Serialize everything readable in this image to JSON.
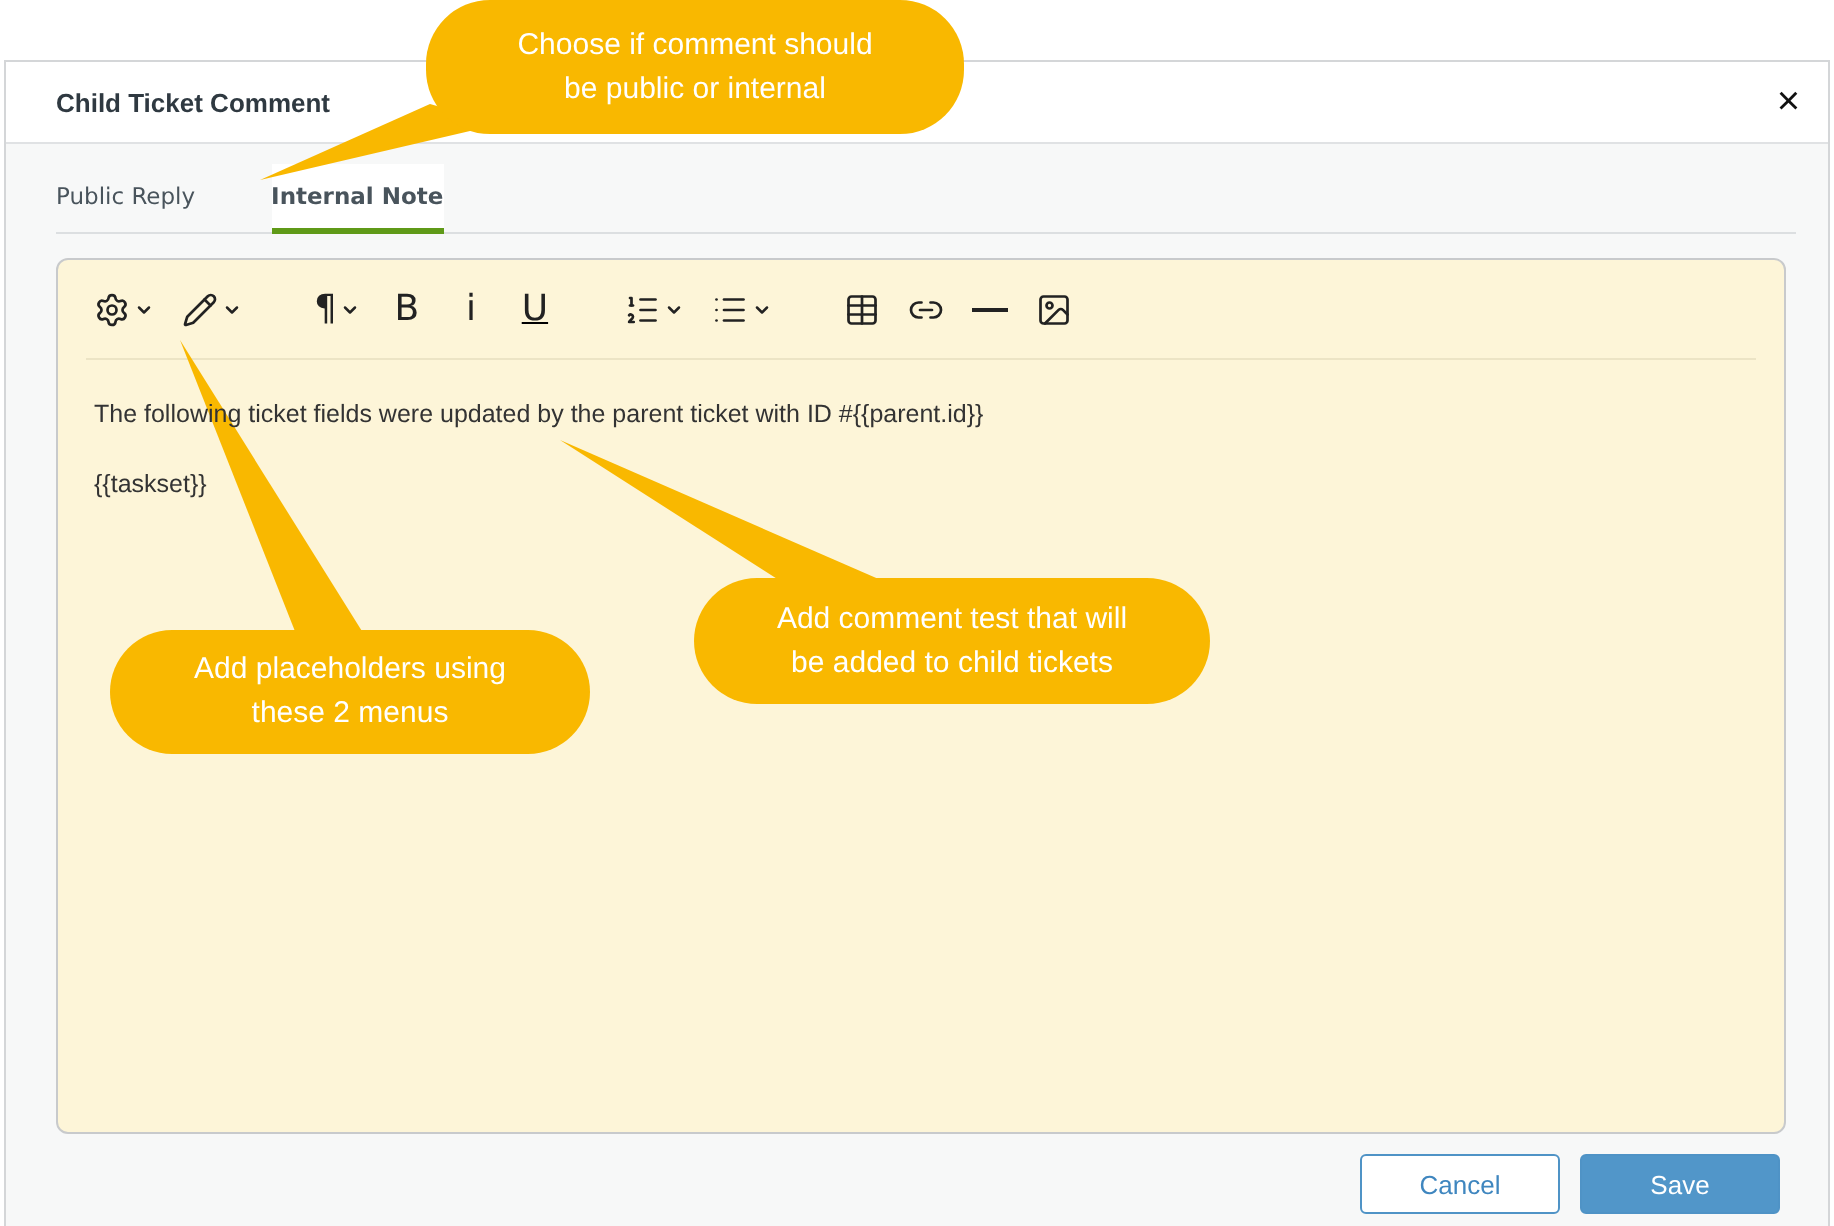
{
  "dialog": {
    "title": "Child Ticket Comment",
    "close": "×"
  },
  "tabs": [
    {
      "label": "Public Reply",
      "selected": false
    },
    {
      "label": "Internal Note",
      "selected": true
    }
  ],
  "toolbar": [
    [
      {
        "kind": "icon",
        "dropdown": true
      },
      {
        "kind": "icon",
        "dropdown": true
      }
    ],
    [
      {
        "kind": "glyph",
        "text": "¶",
        "dropdown": true
      },
      {
        "kind": "glyph",
        "text": "B",
        "dropdown": false
      },
      {
        "kind": "glyph",
        "text": "i",
        "dropdown": false
      },
      {
        "kind": "glyph",
        "text": "U",
        "dropdown": false
      }
    ],
    [
      {
        "kind": "icon",
        "dropdown": true
      },
      {
        "kind": "icon",
        "dropdown": true
      }
    ],
    [
      {
        "kind": "icon",
        "dropdown": false
      },
      {
        "kind": "icon",
        "dropdown": false
      },
      {
        "kind": "icon",
        "dropdown": false
      },
      {
        "kind": "icon",
        "dropdown": false
      }
    ]
  ],
  "editor": {
    "paragraphs": [
      "The following ticket fields were updated by the parent ticket with ID #{{parent.id}}",
      "{{taskset}}"
    ]
  },
  "buttons": [
    {
      "label": "Cancel",
      "kind": "secondary"
    },
    {
      "label": "Save",
      "kind": "primary"
    }
  ],
  "callouts": [
    "Choose if comment should be public or internal",
    "Add placeholders using these 2 menus",
    "Add comment test that will be added to child tickets"
  ]
}
